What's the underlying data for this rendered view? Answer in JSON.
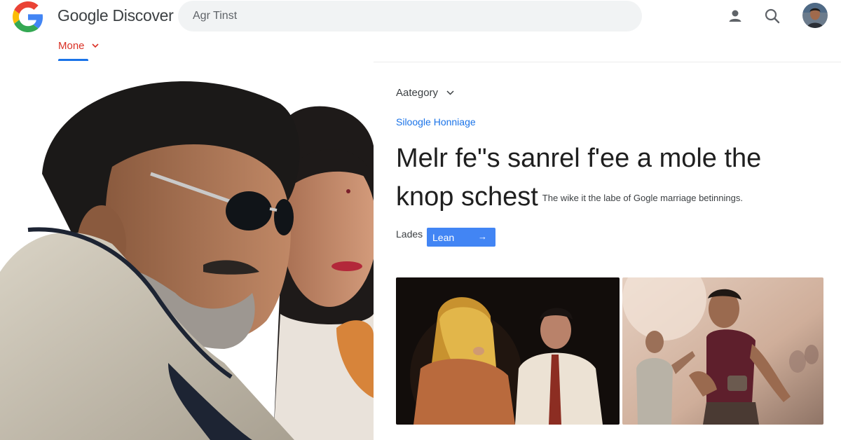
{
  "header": {
    "brand": "Google Discover",
    "search_value": "Agr Tinst",
    "icons": [
      "google-g-logo",
      "person-icon",
      "search-icon",
      "avatar"
    ]
  },
  "nav": {
    "active_tab": "Mone"
  },
  "article": {
    "category_label": "Aategory",
    "source": "Siloogle Honniage",
    "headline_line1": "Melr fe\"s sanrel f'ee a mole the",
    "headline_line2": "knop schest",
    "subtext": "The wike it the labe of Gogle marriage betinnings.",
    "lades_label": "Lades",
    "learn_button": "Lean",
    "learn_arrow": "→"
  },
  "colors": {
    "accent_blue": "#1a73e8",
    "button_blue": "#4285f4",
    "tab_red": "#d93025",
    "search_bg": "#f1f3f4"
  }
}
